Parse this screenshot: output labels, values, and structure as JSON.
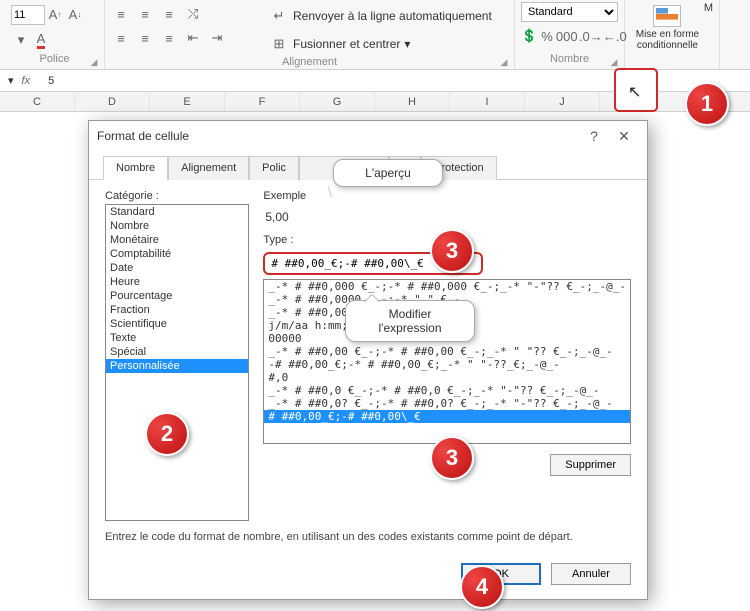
{
  "ribbon": {
    "font_size": "11",
    "increase_font_tip": "A",
    "decrease_font_tip": "A",
    "wrap_text": "Renvoyer à la ligne automatiquement",
    "merge_center": "Fusionner et centrer",
    "number_format": "Standard",
    "cond_format": "Mise en forme conditionnelle",
    "cond_format_trunc": "M",
    "groups": {
      "police": "Police",
      "alignement": "Alignement",
      "nombre": "Nombre"
    }
  },
  "formula_bar": {
    "fx": "fx",
    "value": "5"
  },
  "col_headers": [
    "C",
    "D",
    "E",
    "F",
    "G",
    "H",
    "I",
    "J"
  ],
  "dialog": {
    "title": "Format de cellule",
    "help": "?",
    "close": "✕",
    "tabs": {
      "nombre": "Nombre",
      "alignement": "Alignement",
      "police": "Polic",
      "bordure": "",
      "remplissage": "e",
      "protection": "Protection"
    },
    "categorie_label": "Catégorie :",
    "categories": [
      "Standard",
      "Nombre",
      "Monétaire",
      "Comptabilité",
      "Date",
      "Heure",
      "Pourcentage",
      "Fraction",
      "Scientifique",
      "Texte",
      "Spécial",
      "Personnalisée"
    ],
    "selected_category_index": 11,
    "exemple_label": "Exemple",
    "exemple_value": "5,00",
    "type_label": "Type :",
    "type_value": "# ##0,00_€;-# ##0,00\\_€",
    "format_items": [
      "_-* # ##0,000 €_-;-* # ##0,000 €_-;_-* \"-\"?? €_-;_-@_-",
      "_-* # ##0,0000 €_-;-* \" \"_€_-",
      "_-* # ##0,00000 €_-;-* \" \"_€_-  ",
      "j/m/aa h:mm;@",
      "00000",
      "_-* # ##0,00 €_-;-* # ##0,00 €_-;_-* \" \"?? €_-;_-@_-",
      "-# ##0,00_€;-* # ##0,00_€;_-* \" \"-??_€;_-@_-",
      "#,0",
      "_-* # ##0,0 €_-;-* # ##0,0 €_-;_-* \"-\"?? €_-;_-@_-",
      "_-* # ##0,0? €_-;-* # ##0,0? €_-;_-* \"-\"?? €_-;_-@_-",
      "# ##0,00_€;-# ##0,00\\_€"
    ],
    "selected_format_index": 10,
    "supprimer": "Supprimer",
    "hint": "Entrez le code du format de nombre, en utilisant un des codes existants comme point de départ.",
    "ok": "OK",
    "annuler": "Annuler"
  },
  "callouts": {
    "apercu": "L'aperçu",
    "modifier": "Modifier l'expression"
  },
  "badges": {
    "b1": "1",
    "b2": "2",
    "b3": "3",
    "b4": "4"
  }
}
